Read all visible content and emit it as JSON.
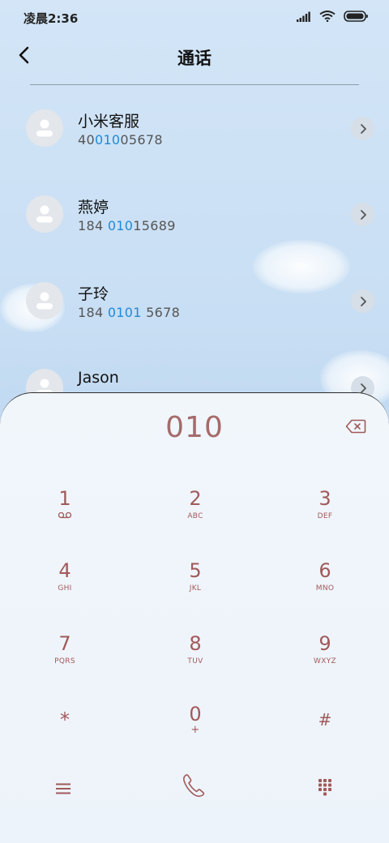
{
  "status_bar": {
    "time": "凌晨2:36"
  },
  "header": {
    "title": "通话"
  },
  "contacts": [
    {
      "name": "小米客服",
      "number_pre": "40",
      "number_hl": "010",
      "number_post": "05678"
    },
    {
      "name": "燕婷",
      "number_pre": "184 ",
      "number_hl": "010",
      "number_post": "15689"
    },
    {
      "name": "子玲",
      "number_pre": "184 ",
      "number_hl": "0101",
      "number_post": " 5678"
    },
    {
      "name": "Jason",
      "number_pre": "",
      "number_hl": "",
      "number_post": ""
    }
  ],
  "dialpad": {
    "display": "010",
    "keys": [
      {
        "digit": "1",
        "letters": ""
      },
      {
        "digit": "2",
        "letters": "ABC"
      },
      {
        "digit": "3",
        "letters": "DEF"
      },
      {
        "digit": "4",
        "letters": "GHI"
      },
      {
        "digit": "5",
        "letters": "JKL"
      },
      {
        "digit": "6",
        "letters": "MNO"
      },
      {
        "digit": "7",
        "letters": "PQRS"
      },
      {
        "digit": "8",
        "letters": "TUV"
      },
      {
        "digit": "9",
        "letters": "WXYZ"
      },
      {
        "digit": "*",
        "letters": ""
      },
      {
        "digit": "0",
        "letters": "+"
      },
      {
        "digit": "#",
        "letters": ""
      }
    ]
  },
  "colors": {
    "accent_highlight": "#1f8ad6",
    "dial_text": "#a05a5a"
  },
  "icons": {
    "back": "chevron-left-icon",
    "backspace": "backspace-icon",
    "voicemail": "voicemail-icon",
    "menu": "menu-icon",
    "call": "phone-icon",
    "keypad": "keypad-icon"
  }
}
